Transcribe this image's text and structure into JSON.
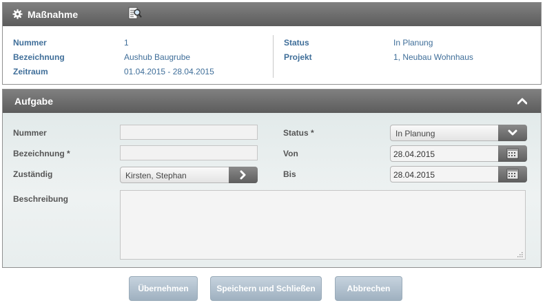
{
  "massnahme": {
    "title": "Maßnahme",
    "header_icons": [
      "gear-icon",
      "document-search-icon"
    ],
    "fields": {
      "nummer_label": "Nummer",
      "nummer_value": "1",
      "bezeichnung_label": "Bezeichnung",
      "bezeichnung_value": "Aushub Baugrube",
      "zeitraum_label": "Zeitraum",
      "zeitraum_value": "01.04.2015 - 28.04.2015",
      "status_label": "Status",
      "status_value": "In Planung",
      "projekt_label": "Projekt",
      "projekt_value": "1, Neubau Wohnhaus"
    }
  },
  "aufgabe": {
    "title": "Aufgabe",
    "collapse_icon": "chevron-up-icon",
    "form": {
      "nummer_label": "Nummer",
      "nummer_value": "",
      "bezeichnung_label": "Bezeichnung *",
      "bezeichnung_value": "",
      "zustaendig_label": "Zuständig",
      "zustaendig_value": "Kirsten, Stephan",
      "beschreibung_label": "Beschreibung",
      "beschreibung_value": "",
      "status_label": "Status *",
      "status_value": "In Planung",
      "von_label": "Von",
      "von_value": "28.04.2015",
      "bis_label": "Bis",
      "bis_value": "28.04.2015"
    }
  },
  "actions": {
    "uebernehmen": "Übernehmen",
    "speichern_schliessen": "Speichern und Schließen",
    "abbrechen": "Abbrechen"
  },
  "colors": {
    "label_blue": "#3f6e99",
    "header_grey": "#6e6e6e",
    "button_blue": "#aebfcd"
  }
}
